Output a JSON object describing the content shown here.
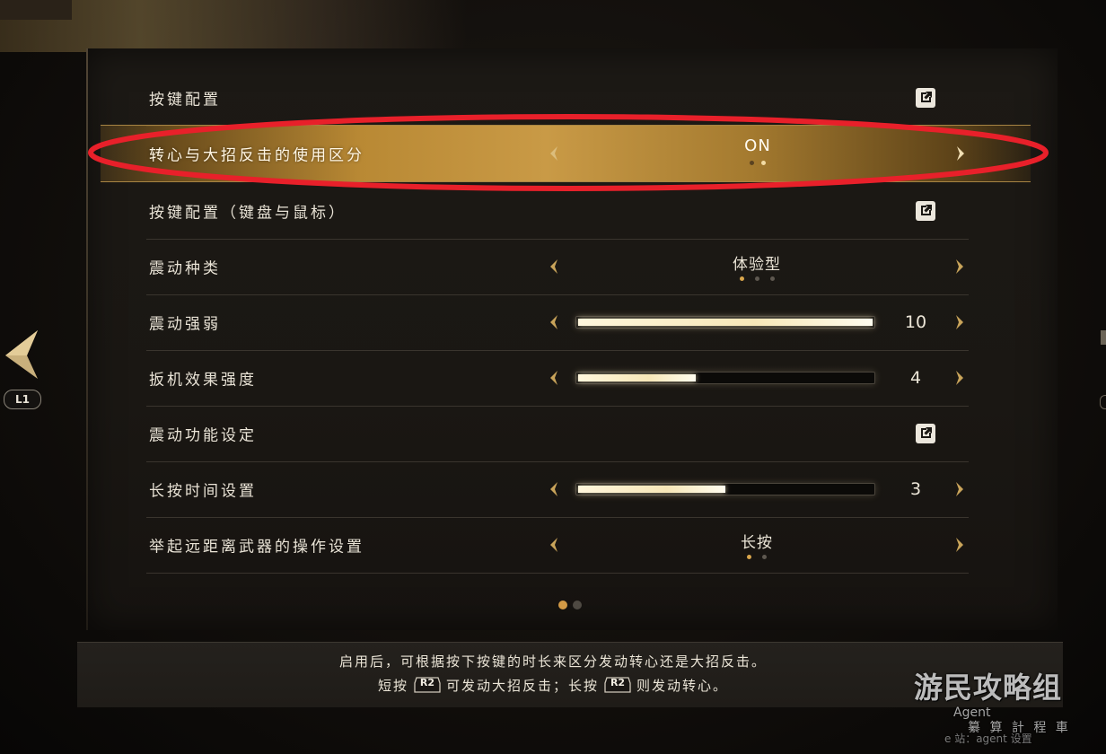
{
  "settings": {
    "rows": [
      {
        "label": "按键配置",
        "type": "link"
      },
      {
        "label": "转心与大招反击的使用区分",
        "type": "select",
        "value": "ON",
        "options_count": 2,
        "selected_index": 1,
        "highlighted": true
      },
      {
        "label": "按键配置（键盘与鼠标）",
        "type": "link"
      },
      {
        "label": "震动种类",
        "type": "select",
        "value": "体验型",
        "options_count": 3,
        "selected_index": 0
      },
      {
        "label": "震动强弱",
        "type": "slider",
        "value": "10",
        "fraction": 1.0
      },
      {
        "label": "扳机效果强度",
        "type": "slider",
        "value": "4",
        "fraction": 0.4
      },
      {
        "label": "震动功能设定",
        "type": "link"
      },
      {
        "label": "长按时间设置",
        "type": "slider",
        "value": "3",
        "fraction": 0.5
      },
      {
        "label": "举起远距离武器的操作设置",
        "type": "select",
        "value": "长按",
        "options_count": 2,
        "selected_index": 0
      }
    ],
    "page_count": 2,
    "page_selected": 0
  },
  "nav": {
    "prev_button_label": "L1"
  },
  "description": {
    "line1": "启用后，可根据按下按键的时长来区分发动转心还是大招反击。",
    "line2_a": "短按",
    "line2_b": "可发动大招反击；长按",
    "line2_c": "则发动转心。",
    "button_label": "R2"
  },
  "watermark": {
    "title": "游民攻略组",
    "agent": "Agent",
    "sub": "纂 算 計 程 車",
    "tiny": "e 站：agent 设置"
  },
  "colors": {
    "accent_gold": "#d39a46",
    "highlight_gold": "#c99a46",
    "annotation_red": "#e8202a"
  },
  "icons": {
    "arrow_left": "chevron-left-icon",
    "arrow_right": "chevron-right-icon",
    "link": "external-link-icon",
    "nav_prev": "triangle-left-icon"
  }
}
